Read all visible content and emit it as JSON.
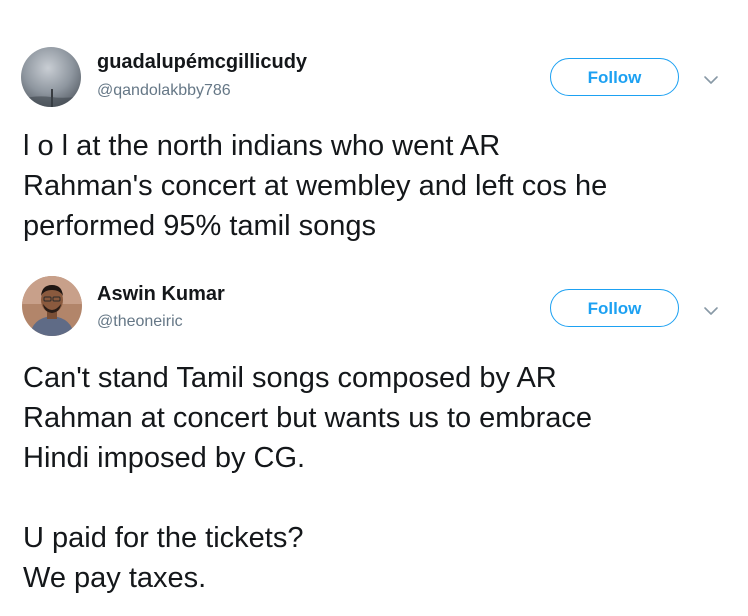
{
  "tweets": [
    {
      "display_name": "guadalupémcgillicudy",
      "handle": "@qandolakbby786",
      "follow_label": "Follow",
      "text": "l o l at the north indians who went AR\nRahman's concert at wembley and left cos he\nperformed 95% tamil songs",
      "avatar": "sky-avatar"
    },
    {
      "display_name": "Aswin Kumar",
      "handle": "@theoneiric",
      "follow_label": "Follow",
      "text": "Can't stand Tamil songs composed by AR\nRahman at concert but wants us to embrace\nHindi imposed by CG.\n\nU paid for the tickets?\nWe pay taxes.",
      "avatar": "person-avatar"
    }
  ],
  "colors": {
    "accent": "#1da1f2",
    "secondary_text": "#657786",
    "primary_text": "#14171a"
  },
  "icons": {
    "menu": "chevron-down-icon"
  }
}
